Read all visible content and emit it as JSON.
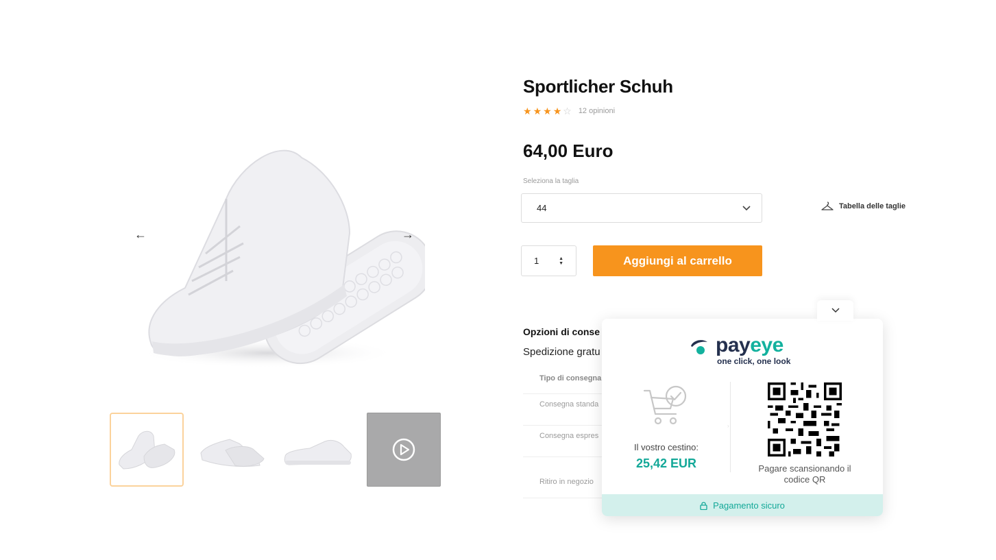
{
  "gallery": {
    "prev_label": "←",
    "next_label": "→",
    "thumbnails": [
      "shoe-pair-thumb",
      "shoe-side-thumb",
      "shoe-profile-thumb",
      "shoe-video-thumb"
    ]
  },
  "product": {
    "title": "Sportlicher Schuh",
    "rating": {
      "stars": 4,
      "max": 5,
      "reviews_label": "12 opinioni"
    },
    "price": "64,00 Euro",
    "size_label": "Seleziona la taglia",
    "size_value": "44",
    "size_table_label": "Tabella delle taglie",
    "quantity": "1",
    "add_to_cart_label": "Aggiungi al carrello"
  },
  "delivery": {
    "title": "Opzioni di conse",
    "subtitle": "Spedizione gratu",
    "rows": [
      "Tipo di consegna",
      "Consegna standa",
      "Consegna espres",
      "Ritiro in negozio"
    ]
  },
  "payeye": {
    "brand_pay": "pay",
    "brand_eye": "eye",
    "tagline": "one click, one look",
    "cart_label": "Il vostro cestino:",
    "cart_amount": "25,42 EUR",
    "qr_label": "Pagare scansionando il codice QR",
    "secure_label": "Pagamento sicuro",
    "accent_color": "#13b19e",
    "brand_color": "#24304e"
  },
  "colors": {
    "primary_button": "#f7941d",
    "star": "#f7941d"
  }
}
